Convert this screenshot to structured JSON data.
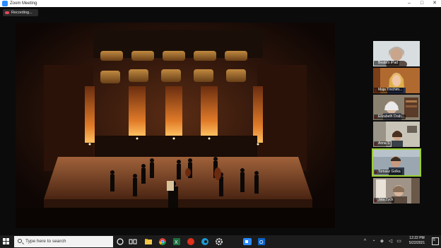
{
  "window": {
    "title": "Zoom Meeting",
    "controls": {
      "minimize": "–",
      "maximize": "□",
      "close": "✕"
    }
  },
  "recording": {
    "label": "Recording..."
  },
  "participants": [
    {
      "name": "Beata's iPad",
      "muted": false
    },
    {
      "name": "Maja Trochim...",
      "muted": true
    },
    {
      "name": "Elizabeth Drab...",
      "muted": true
    },
    {
      "name": "Anna S",
      "muted": true
    },
    {
      "name": "Tomasz Golka",
      "muted": true,
      "active_speaker": true
    },
    {
      "name": "Jola Zych",
      "muted": true
    }
  ],
  "taskbar": {
    "search_placeholder": "Type here to search",
    "apps": [
      "cortana-icon",
      "task-view-icon",
      "file-explorer-icon",
      "chrome-icon",
      "excel-icon",
      "acrobat-icon",
      "edge-icon",
      "settings-icon",
      "zoom-icon",
      "outlook-icon"
    ],
    "time": "12:22 PM",
    "date": "5/22/2021",
    "notification_count": "5"
  },
  "colors": {
    "zoom_blue": "#2d8cff",
    "active_speaker_border": "#9acd32",
    "recording_red": "#e3475a",
    "taskbar": "#1c1c1c"
  }
}
